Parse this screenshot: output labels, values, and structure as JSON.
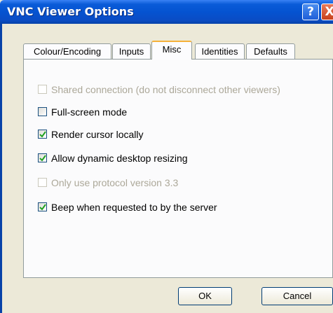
{
  "window": {
    "title": "VNC Viewer Options",
    "help_glyph": "?",
    "close_glyph": "X"
  },
  "tabs": [
    {
      "label": "Colour/Encoding",
      "active": false
    },
    {
      "label": "Inputs",
      "active": false
    },
    {
      "label": "Misc",
      "active": true
    },
    {
      "label": "Identities",
      "active": false
    },
    {
      "label": "Defaults",
      "active": false
    }
  ],
  "options": [
    {
      "label": "Shared connection (do not disconnect other viewers)",
      "checked": false,
      "enabled": false
    },
    {
      "label": "Full-screen mode",
      "checked": false,
      "enabled": true
    },
    {
      "label": "Render cursor locally",
      "checked": true,
      "enabled": true
    },
    {
      "label": "Allow dynamic desktop resizing",
      "checked": true,
      "enabled": true
    },
    {
      "label": "Only use protocol version 3.3",
      "checked": false,
      "enabled": false
    },
    {
      "label": "Beep when requested to by the server",
      "checked": true,
      "enabled": true
    }
  ],
  "buttons": {
    "ok": "OK",
    "cancel": "Cancel"
  },
  "colors": {
    "titlebar": "#0553d1",
    "checkmark": "#21a121",
    "active_tab_accent": "#f5b13a"
  }
}
